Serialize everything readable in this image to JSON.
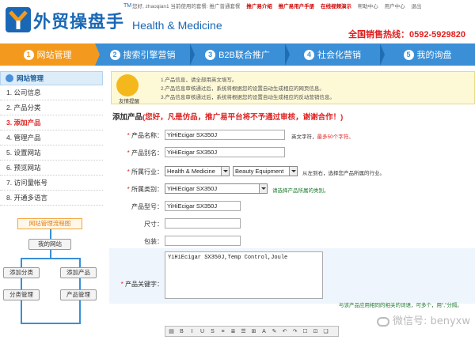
{
  "header": {
    "logo_cn": "外贸操盘手",
    "logo_tm": "TM",
    "logo_en": "Health & Medicine",
    "userbar": {
      "greeting": "您好, zhaoqian1 当前使用的套餐: 推广普通套餐",
      "links": [
        "推广易介绍",
        "推广易用户手册",
        "在线视频演示",
        "帮助中心",
        "用户中心",
        "退出"
      ]
    },
    "hotline_label": "全国销售热线：",
    "hotline_number": "0592-5929820"
  },
  "nav": {
    "items": [
      {
        "num": "1",
        "label": "网站管理",
        "active": true
      },
      {
        "num": "2",
        "label": "搜索引擎营销",
        "active": false
      },
      {
        "num": "3",
        "label": "B2B联合推广",
        "active": false
      },
      {
        "num": "4",
        "label": "社会化营销",
        "active": false
      },
      {
        "num": "5",
        "label": "我的询盘",
        "active": false
      }
    ]
  },
  "sidebar": {
    "title": "网站管理",
    "items": [
      {
        "label": "1. 公司信息"
      },
      {
        "label": "2. 产品分类"
      },
      {
        "label": "3. 添加产品",
        "active": true
      },
      {
        "label": "4. 管理产品"
      },
      {
        "label": "5. 设置网站"
      },
      {
        "label": "6. 预览网站"
      },
      {
        "label": "7. 访问量帐号"
      },
      {
        "label": "8. 开通多语言"
      }
    ],
    "flow": {
      "title": "网站管理流程图",
      "my_site": "我的网站",
      "add_category": "添加分类",
      "add_product": "添加产品",
      "manage_category": "分类管理",
      "manage_product": "产品管理"
    }
  },
  "notice": {
    "mascot_label": "友情提醒",
    "lines": [
      "1.产品信息，请全部用英文填写。",
      "2.产品信息审核通过后，系统将根据您的设置自动生成相应的网页信息。",
      "3.产品信息审核通过后，系统将根据您的设置自动生成相应的反动营销信息。"
    ]
  },
  "form": {
    "title": "添加产品",
    "title_warning": "(您好，凡是仿品，推广易平台将不予通过审核，谢谢合作！)",
    "product_name": {
      "label": "产品名称：",
      "value": "YiHiEcigar SX350J",
      "hint_prefix": "英文字符，",
      "hint_red": "最多50个字符。"
    },
    "product_alias": {
      "label": "产品别名：",
      "value": "YiHiEcigar SX350J"
    },
    "industry": {
      "label": "所属行业：",
      "value1": "Health & Medicine",
      "value2": "Beauty Equipment",
      "hint": "从左到右，选择您产品所属的行业。"
    },
    "category": {
      "label": "所属类别：",
      "value": "YiHiEcigar SX350J",
      "hint": "请选择产品所属的类别。"
    },
    "model": {
      "label": "产品型号：",
      "value": "YiHiEcigar SX350J"
    },
    "size": {
      "label": "尺寸：",
      "value": ""
    },
    "packaging": {
      "label": "包装：",
      "value": ""
    },
    "keywords": {
      "label": "产品关键字：",
      "value": "YiHiEcigar SX350J,Temp Control,Joule",
      "hint": "与该产品应用相同的相关的词语，可多个，用\",\"分隔。"
    }
  },
  "toolbar": {
    "buttons": [
      "▤",
      "B",
      "I",
      "U",
      "S",
      "≡",
      "≣",
      "☰",
      "⊞",
      "A",
      "✎",
      "↶",
      "↷",
      "☐",
      "⊡",
      "❏"
    ]
  },
  "watermark": "微信号: benyxw",
  "colors": {
    "nav_blue": "#3a8fd6",
    "nav_active_orange": "#f39a1e",
    "brand_blue": "#1a68b5",
    "hotline_red": "#e02020",
    "warning_red": "#d22222"
  }
}
